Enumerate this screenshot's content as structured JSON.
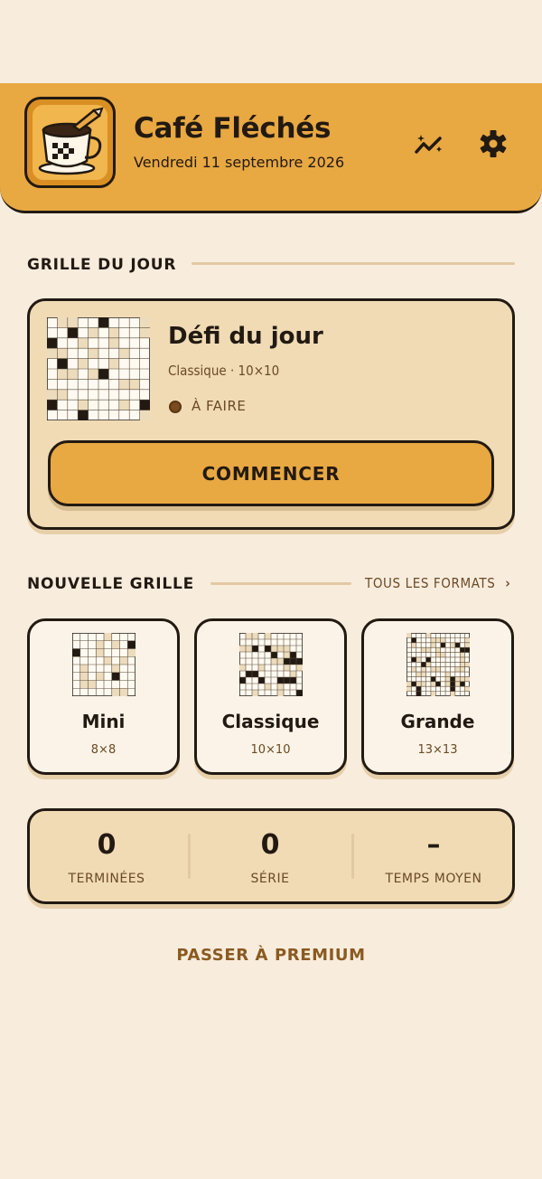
{
  "header": {
    "app_title": "Café Fléchés",
    "date": "Vendredi 11 septembre 2026",
    "logo_icon": "coffee-cup-pencil-icon",
    "stats_icon": "stats-sparkle-icon",
    "settings_icon": "gear-icon"
  },
  "daily": {
    "section_title": "GRILLE DU JOUR",
    "title": "Défi du jour",
    "subtitle": "Classique · 10×10",
    "status": "À FAIRE",
    "start_label": "COMMENCER"
  },
  "new_grid": {
    "section_title": "NOUVELLE GRILLE",
    "all_formats_label": "TOUS LES FORMATS",
    "formats": [
      {
        "name": "Mini",
        "size": "8×8"
      },
      {
        "name": "Classique",
        "size": "10×10"
      },
      {
        "name": "Grande",
        "size": "13×13"
      }
    ]
  },
  "stats": [
    {
      "value": "0",
      "label": "TERMINÉES"
    },
    {
      "value": "0",
      "label": "SÉRIE"
    },
    {
      "value": "–",
      "label": "TEMPS MOYEN"
    }
  ],
  "premium_label": "PASSER À PREMIUM",
  "colors": {
    "background": "#f8ecdd",
    "accent": "#e8a842",
    "card": "#f0dbb5",
    "ink": "#221a12",
    "muted": "#6b4a26"
  }
}
